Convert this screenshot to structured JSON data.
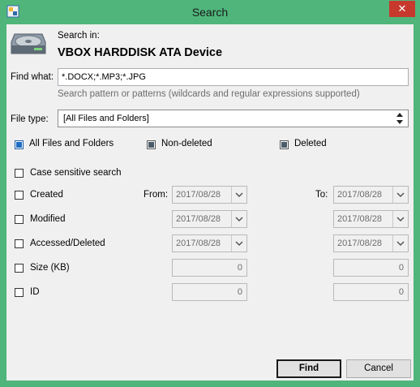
{
  "window": {
    "title": "Search",
    "close_glyph": "✕"
  },
  "search_in": {
    "label": "Search in:",
    "device": "VBOX HARDDISK ATA Device",
    "icon": "hard-drive-icon"
  },
  "find_what": {
    "label": "Find what:",
    "value": "*.DOCX;*.MP3;*.JPG",
    "hint": "Search pattern or patterns (wildcards and regular expressions supported)"
  },
  "file_type": {
    "label": "File type:",
    "selected": "[All Files and Folders]"
  },
  "filter_options": [
    {
      "label": "All Files and Folders",
      "state": "checked"
    },
    {
      "label": "Non-deleted",
      "state": "indeterminate"
    },
    {
      "label": "Deleted",
      "state": "indeterminate"
    }
  ],
  "case_sensitive": {
    "label": "Case sensitive search",
    "checked": false
  },
  "range_labels": {
    "from": "From:",
    "to": "To:"
  },
  "criteria": [
    {
      "label": "Created",
      "checked": false,
      "from": "2017/08/28",
      "to": "2017/08/28"
    },
    {
      "label": "Modified",
      "checked": false,
      "from": "2017/08/28",
      "to": "2017/08/28"
    },
    {
      "label": "Accessed/Deleted",
      "checked": false,
      "from": "2017/08/28",
      "to": "2017/08/28"
    },
    {
      "label": "Size (KB)",
      "checked": false,
      "from": "0",
      "to": "0"
    },
    {
      "label": "ID",
      "checked": false,
      "from": "0",
      "to": "0"
    }
  ],
  "buttons": {
    "find": "Find",
    "cancel": "Cancel"
  },
  "colors": {
    "titlebar": "#4fb57b",
    "close": "#c7392c",
    "accent": "#1e6bc2"
  }
}
